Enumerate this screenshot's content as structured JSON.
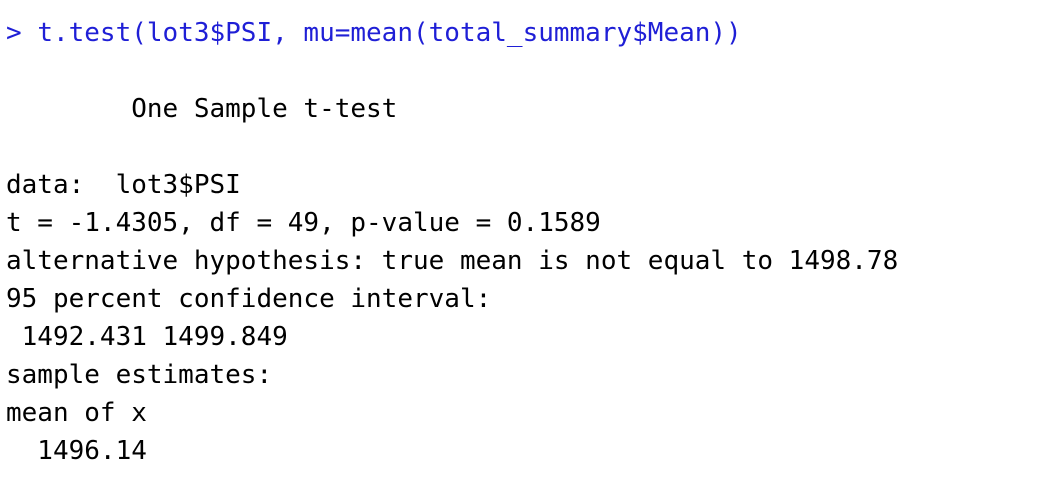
{
  "console": {
    "prompt": "> ",
    "command": "t.test(lot3$PSI, mu=mean(total_summary$Mean))",
    "output_lines": [
      "",
      "        One Sample t-test",
      "",
      "data:  lot3$PSI",
      "t = -1.4305, df = 49, p-value = 0.1589",
      "alternative hypothesis: true mean is not equal to 1498.78",
      "95 percent confidence interval:",
      " 1492.431 1499.849",
      "sample estimates:",
      "mean of x",
      "  1496.14"
    ],
    "colors": {
      "command": "#1f1fd6",
      "output": "#000000",
      "background": "#ffffff"
    }
  }
}
